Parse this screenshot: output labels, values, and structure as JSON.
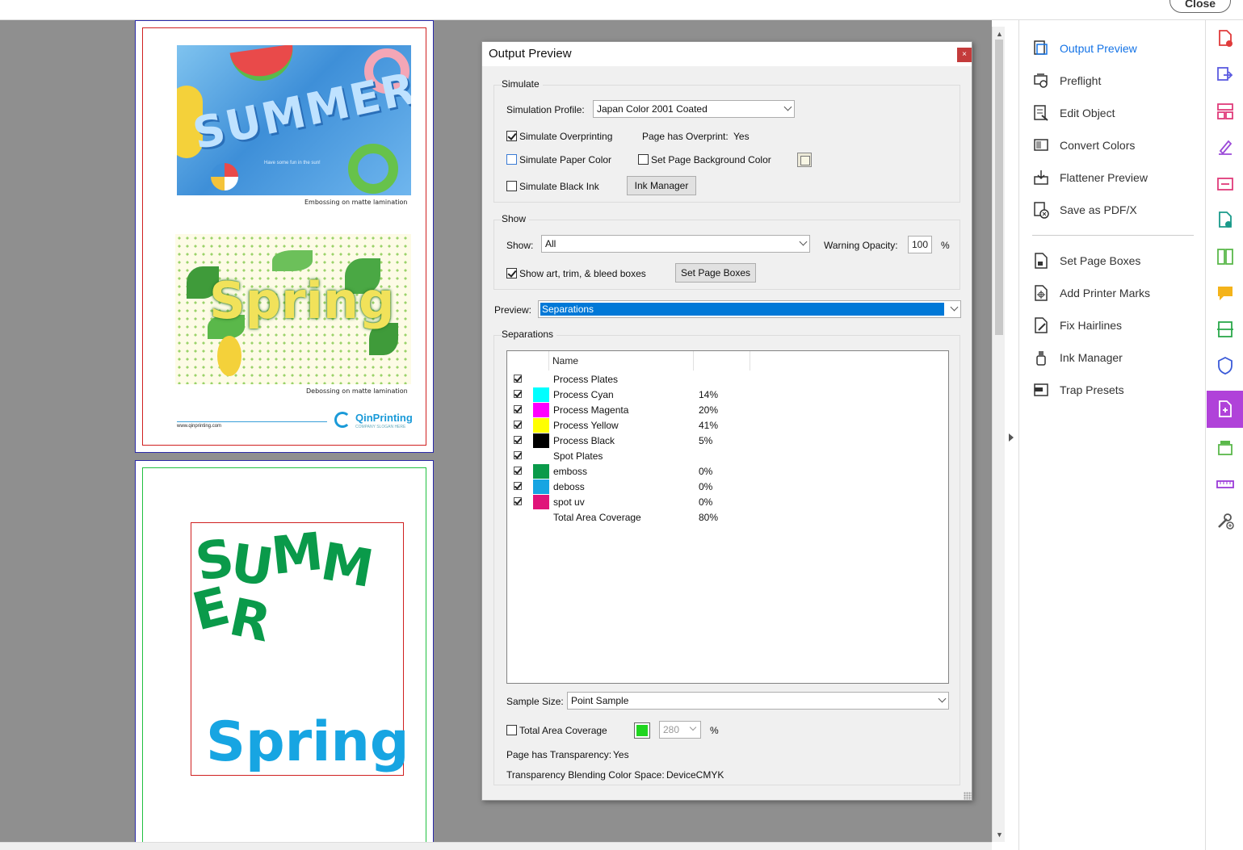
{
  "topbar": {
    "close_label": "Close"
  },
  "page1": {
    "summer_word": "SUMMER",
    "summer_tagline": "Have some fun in the sun!",
    "caption1": "Embossing on matte lamination",
    "spring_word": "Spring",
    "caption2": "Debossing on matte lamination",
    "footer_url": "www.qinprinting.com",
    "brand": "QinPrinting",
    "brand_sub": "COMPANY SLOGAN HERE"
  },
  "page2": {
    "summer_letters": [
      "S",
      "U",
      "M",
      "M",
      "E",
      "R"
    ],
    "spring_word": "Spring"
  },
  "tools": {
    "items": [
      {
        "label": "Output Preview",
        "icon": "output-preview-icon",
        "active": true
      },
      {
        "label": "Preflight",
        "icon": "preflight-icon"
      },
      {
        "label": "Edit Object",
        "icon": "edit-object-icon"
      },
      {
        "label": "Convert Colors",
        "icon": "convert-colors-icon"
      },
      {
        "label": "Flattener Preview",
        "icon": "flattener-preview-icon"
      },
      {
        "label": "Save as PDF/X",
        "icon": "save-pdfx-icon"
      },
      {
        "label": "Set Page Boxes",
        "icon": "set-page-boxes-icon"
      },
      {
        "label": "Add Printer Marks",
        "icon": "add-printer-marks-icon"
      },
      {
        "label": "Fix Hairlines",
        "icon": "fix-hairlines-icon"
      },
      {
        "label": "Ink Manager",
        "icon": "ink-manager-icon"
      },
      {
        "label": "Trap Presets",
        "icon": "trap-presets-icon"
      }
    ]
  },
  "rail": {
    "icons": [
      "create-pdf-icon",
      "export-pdf-icon",
      "organize-pages-icon",
      "fill-sign-icon",
      "combine-files-icon",
      "edit-pdf-icon",
      "compare-files-icon",
      "comment-icon",
      "scan-ocr-icon",
      "protect-icon",
      "print-production-icon",
      "stamp-icon",
      "measure-icon",
      "more-tools-icon"
    ],
    "active_color": "#b042d9"
  },
  "dialog": {
    "title": "Output Preview",
    "close": "×",
    "simulate": {
      "title": "Simulate",
      "profile_label": "Simulation Profile:",
      "profile_value": "Japan Color 2001 Coated",
      "overprinting_label": "Simulate Overprinting",
      "overprint_status_label": "Page has Overprint:",
      "overprint_status_value": "Yes",
      "paper_color_label": "Simulate Paper Color",
      "page_bg_label": "Set Page Background Color",
      "black_ink_label": "Simulate Black Ink",
      "ink_manager_button": "Ink Manager"
    },
    "show": {
      "title": "Show",
      "show_label": "Show:",
      "show_value": "All",
      "warning_label": "Warning Opacity:",
      "warning_value": "100",
      "percent": "%",
      "boxes_label": "Show art, trim, & bleed boxes",
      "set_page_boxes_button": "Set Page Boxes"
    },
    "preview": {
      "label": "Preview:",
      "value": "Separations"
    },
    "separations": {
      "title": "Separations",
      "column_name": "Name",
      "rows": [
        {
          "name": "Process Plates",
          "pct": "",
          "color": "",
          "checked": true
        },
        {
          "name": "Process Cyan",
          "pct": "14%",
          "color": "#00ffff",
          "checked": true
        },
        {
          "name": "Process Magenta",
          "pct": "20%",
          "color": "#ff00ff",
          "checked": true
        },
        {
          "name": "Process Yellow",
          "pct": "41%",
          "color": "#ffff00",
          "checked": true
        },
        {
          "name": "Process Black",
          "pct": "5%",
          "color": "#000000",
          "checked": true
        },
        {
          "name": "Spot Plates",
          "pct": "",
          "color": "",
          "checked": true
        },
        {
          "name": "emboss",
          "pct": "0%",
          "color": "#0a9a4a",
          "checked": true
        },
        {
          "name": "deboss",
          "pct": "0%",
          "color": "#17a5e2",
          "checked": true
        },
        {
          "name": "spot uv",
          "pct": "0%",
          "color": "#e0147a",
          "checked": true
        },
        {
          "name": "Total Area Coverage",
          "pct": "80%",
          "color": "",
          "checked": false
        }
      ]
    },
    "sample_size": {
      "label": "Sample Size:",
      "value": "Point Sample"
    },
    "tac": {
      "label": "Total Area Coverage",
      "value": "280",
      "percent": "%"
    },
    "transparency": {
      "label": "Page has Transparency:",
      "value": "Yes"
    },
    "blending": {
      "label": "Transparency Blending Color Space:",
      "value": "DeviceCMYK"
    }
  }
}
